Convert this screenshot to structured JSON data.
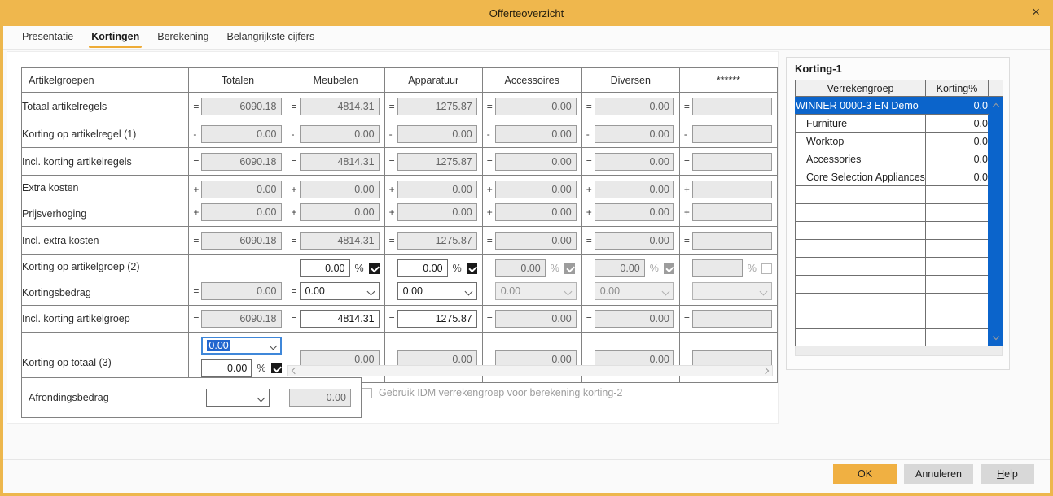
{
  "dialog": {
    "title": "Offerteoverzicht",
    "close_icon": "×"
  },
  "tabs": [
    {
      "label": "Presentatie"
    },
    {
      "label": "Kortingen"
    },
    {
      "label": "Berekening"
    },
    {
      "label": "Belangrijkste cijfers"
    }
  ],
  "table": {
    "headers": {
      "groups": "Artikelgroepen",
      "totalen": "Totalen",
      "meubelen": "Meubelen",
      "apparatuur": "Apparatuur",
      "accessoires": "Accessoires",
      "diversen": "Diversen",
      "masked": "******"
    },
    "rows": {
      "r1": {
        "label": "Totaal artikelregels",
        "op": "=",
        "totalen": "6090.18",
        "meubelen": "4814.31",
        "apparatuur": "1275.87",
        "accessoires": "0.00",
        "diversen": "0.00",
        "masked": ""
      },
      "r2": {
        "label": "Korting op artikelregel (1)",
        "op": "-",
        "totalen": "0.00",
        "meubelen": "0.00",
        "apparatuur": "0.00",
        "accessoires": "0.00",
        "diversen": "0.00",
        "masked": ""
      },
      "r3": {
        "label": "Incl. korting artikelregels",
        "op": "=",
        "totalen": "6090.18",
        "meubelen": "4814.31",
        "apparatuur": "1275.87",
        "accessoires": "0.00",
        "diversen": "0.00",
        "masked": ""
      },
      "r4": {
        "label_line1": "Extra kosten",
        "label_line2": "Prijsverhoging",
        "op": "+",
        "line1": {
          "totalen": "0.00",
          "meubelen": "0.00",
          "apparatuur": "0.00",
          "accessoires": "0.00",
          "diversen": "0.00",
          "masked": ""
        },
        "line2": {
          "totalen": "0.00",
          "meubelen": "0.00",
          "apparatuur": "0.00",
          "accessoires": "0.00",
          "diversen": "0.00",
          "masked": ""
        }
      },
      "r5": {
        "label": "Incl. extra kosten",
        "op": "=",
        "totalen": "6090.18",
        "meubelen": "4814.31",
        "apparatuur": "1275.87",
        "accessoires": "0.00",
        "diversen": "0.00",
        "masked": ""
      },
      "r6": {
        "label_line1": "Korting op artikelgroep (2)",
        "label_line2": "Kortingsbedrag",
        "pct_label": "%",
        "eq": "=",
        "totalen_amount": "0.00",
        "meubelen": {
          "pct": "0.00",
          "amount": "0.00"
        },
        "apparatuur": {
          "pct": "0.00",
          "amount": "0.00"
        },
        "accessoires": {
          "pct": "0.00",
          "amount": "0.00"
        },
        "diversen": {
          "pct": "0.00",
          "amount": "0.00"
        },
        "masked": {
          "pct": "",
          "amount": ""
        }
      },
      "r7": {
        "label": "Incl. korting artikelgroep",
        "op": "=",
        "totalen": "6090.18",
        "meubelen": "4814.31",
        "apparatuur": "1275.87",
        "accessoires": "0.00",
        "diversen": "0.00",
        "masked": ""
      },
      "r8": {
        "label": "Korting op totaal (3)",
        "pct_label": "%",
        "totalen_select": "0.00",
        "totalen_pct": "0.00",
        "meubelen": "0.00",
        "apparatuur": "0.00",
        "accessoires": "0.00",
        "diversen": "0.00",
        "masked": ""
      }
    }
  },
  "afronding": {
    "label": "Afrondingsbedrag",
    "select_value": "",
    "amount": "0.00"
  },
  "idm_checkbox": {
    "label": "Gebruik IDM verrekengroep voor berekening korting-2",
    "checked": false
  },
  "korting1": {
    "title": "Korting-1",
    "col_group": "Verrekengroep",
    "col_pct": "Korting%",
    "rows": [
      {
        "name": "WINNER 0000-3 EN Demo",
        "pct": "0.0",
        "selected": true
      },
      {
        "name": "Furniture",
        "pct": "0.0",
        "selected": false
      },
      {
        "name": "Worktop",
        "pct": "0.0",
        "selected": false
      },
      {
        "name": "Accessories",
        "pct": "0.0",
        "selected": false
      },
      {
        "name": "Core Selection Appliances",
        "pct": "0.0",
        "selected": false
      }
    ],
    "empty_row_count": 9
  },
  "buttons": {
    "ok": "OK",
    "cancel": "Annuleren",
    "help": "Help"
  },
  "colors": {
    "accent": "#edb74d",
    "selection_blue": "#0b64cb",
    "ok_button": "#f0b042",
    "focus_border": "#3f87d9"
  }
}
